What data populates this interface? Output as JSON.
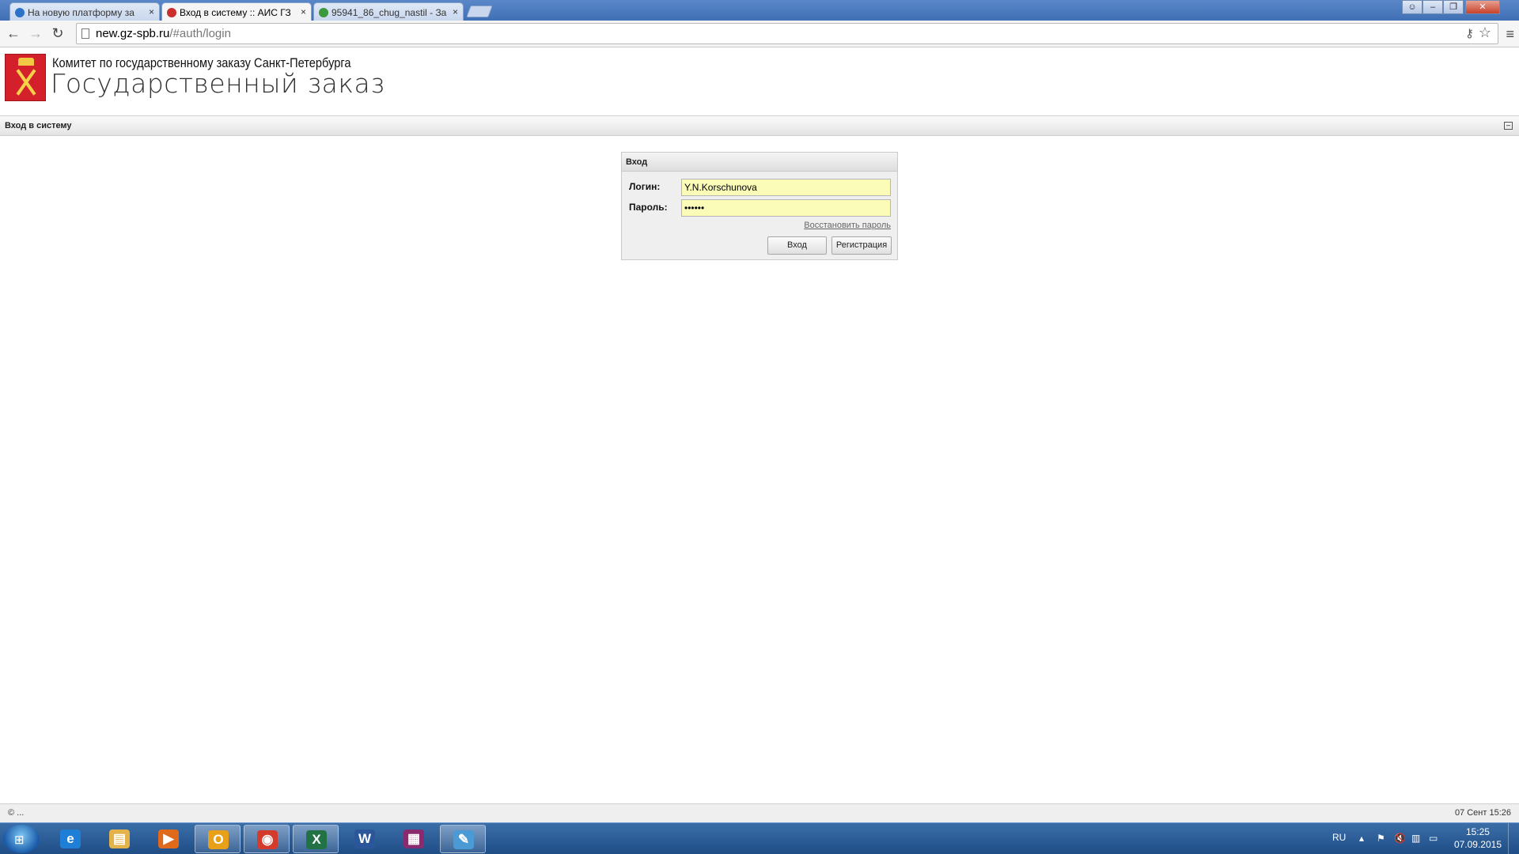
{
  "browser": {
    "tabs": [
      {
        "label": "На новую платформу за",
        "active": false,
        "favicon_color": "#2a73c9"
      },
      {
        "label": "Вход в систему :: АИС ГЗ",
        "active": true,
        "favicon_color": "#c9302c"
      },
      {
        "label": "95941_86_chug_nastil - За",
        "active": false,
        "favicon_color": "#3a9a3a"
      }
    ],
    "tab_close": "×",
    "url_host": "new.gz-spb.ru",
    "url_path": "/#auth/login",
    "icons": {
      "back": "back-arrow-icon",
      "forward": "forward-arrow-icon",
      "reload": "reload-icon",
      "key": "key-icon",
      "star": "star-icon",
      "menu": "hamburger-menu-icon"
    }
  },
  "header": {
    "org_name": "Комитет по государственному заказу Санкт-Петербурга",
    "site_title": "Государственный заказ"
  },
  "panel": {
    "title": "Вход в систему"
  },
  "login": {
    "title": "Вход",
    "login_label": "Логин:",
    "login_value": "Y.N.Korschunova",
    "password_label": "Пароль:",
    "password_value": "••••••",
    "restore_link": "Восстановить пароль",
    "enter_button": "Вход",
    "register_button": "Регистрация",
    "field_bg": "#fafcb8"
  },
  "footer": {
    "copyright": "© ...",
    "datetime": "07 Сент 15:26"
  },
  "taskbar": {
    "apps": [
      {
        "name": "internet-explorer-icon",
        "glyph": "e",
        "color": "#1f7fd6",
        "open": false
      },
      {
        "name": "file-explorer-icon",
        "glyph": "▤",
        "color": "#e3b34a",
        "open": false
      },
      {
        "name": "media-player-icon",
        "glyph": "▶",
        "color": "#e06a1c",
        "open": false
      },
      {
        "name": "outlook-icon",
        "glyph": "O",
        "color": "#e8a019",
        "open": true
      },
      {
        "name": "chrome-icon",
        "glyph": "◉",
        "color": "#d33b2c",
        "open": true
      },
      {
        "name": "excel-icon",
        "glyph": "X",
        "color": "#217346",
        "open": true
      },
      {
        "name": "word-icon",
        "glyph": "W",
        "color": "#2b579a",
        "open": false
      },
      {
        "name": "winrar-icon",
        "glyph": "▦",
        "color": "#8a2a6f",
        "open": false
      },
      {
        "name": "paint-icon",
        "glyph": "✎",
        "color": "#4a9ad6",
        "open": true
      }
    ],
    "lang": "RU",
    "time": "15:25",
    "date": "07.09.2015"
  }
}
